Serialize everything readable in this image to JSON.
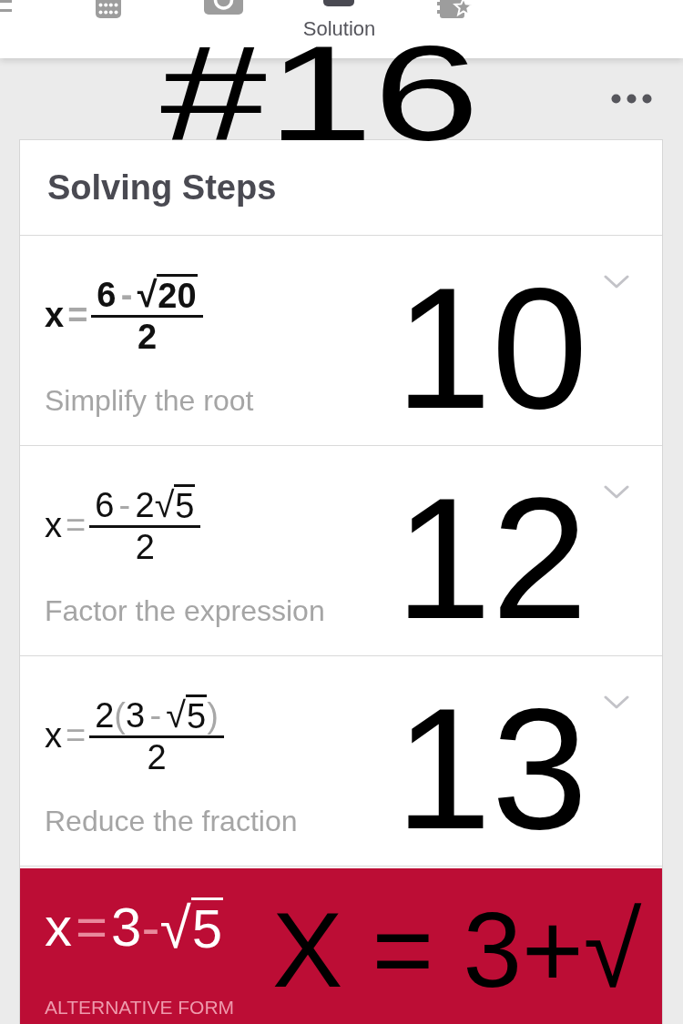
{
  "tab_bar": {
    "tabs": [
      {
        "selected": false
      },
      {
        "selected": false
      },
      {
        "selected": false
      },
      {
        "label": "Solution",
        "selected": true
      },
      {
        "selected": false
      }
    ]
  },
  "handwritten_title": "#16",
  "solving_steps": {
    "title": "Solving Steps",
    "steps": [
      {
        "expression": {
          "lhs": "x",
          "equals": "=",
          "numerator": [
            {
              "kind": "digit",
              "text": "6"
            },
            {
              "kind": "operator",
              "text": "-"
            },
            {
              "kind": "root",
              "sign": "√",
              "text": "20"
            }
          ],
          "denominator": [
            {
              "kind": "digit",
              "text": "2"
            }
          ]
        },
        "description": "Simplify the root",
        "highlighted": true,
        "expanded": false,
        "handwritten_note": "10"
      },
      {
        "expression": {
          "lhs": "x",
          "equals": "=",
          "numerator": [
            {
              "kind": "digit",
              "text": "6"
            },
            {
              "kind": "operator",
              "text": "-"
            },
            {
              "kind": "digit",
              "text": "2"
            },
            {
              "kind": "root",
              "sign": "√",
              "text": "5"
            }
          ],
          "denominator": [
            {
              "kind": "digit",
              "text": "2"
            }
          ]
        },
        "description": "Factor the expression",
        "highlighted": false,
        "expanded": false,
        "handwritten_note": "12"
      },
      {
        "expression": {
          "lhs": "x",
          "equals": "=",
          "numerator": [
            {
              "kind": "digit",
              "text": "2"
            },
            {
              "kind": "paren",
              "text": "("
            },
            {
              "kind": "digit",
              "text": "3"
            },
            {
              "kind": "operator",
              "text": "-"
            },
            {
              "kind": "root",
              "sign": "√",
              "text": "5"
            },
            {
              "kind": "paren",
              "text": ")"
            }
          ],
          "denominator": [
            {
              "kind": "digit",
              "text": "2"
            }
          ]
        },
        "description": "Reduce the fraction",
        "highlighted": false,
        "expanded": false,
        "handwritten_note": "13"
      }
    ]
  },
  "result": {
    "expression": {
      "lhs": "x",
      "equals": "=",
      "value": [
        {
          "kind": "digit",
          "text": "3"
        },
        {
          "kind": "operator",
          "text": "-"
        },
        {
          "kind": "root",
          "sign": "√",
          "text": "5"
        }
      ]
    },
    "label": "ALTERNATIVE FORM",
    "handwritten_note": "X = 3+√"
  }
}
